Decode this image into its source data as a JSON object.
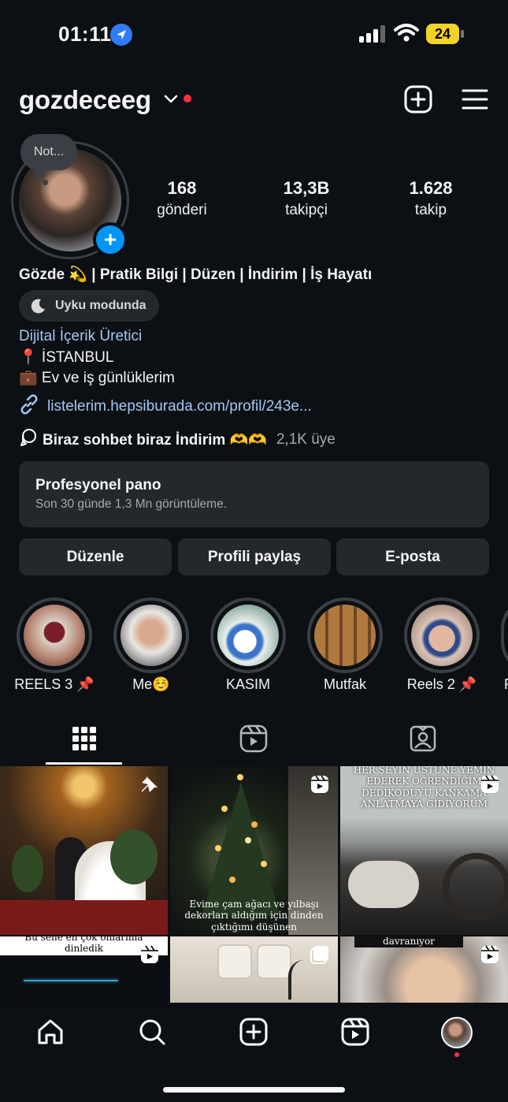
{
  "status_bar": {
    "time": "01:11",
    "battery": "24"
  },
  "header": {
    "username": "gozdeceeg"
  },
  "profile": {
    "note": "Not...",
    "stats": [
      {
        "value": "168",
        "label": "gönderi"
      },
      {
        "value": "13,3B",
        "label": "takipçi"
      },
      {
        "value": "1.628",
        "label": "takip"
      }
    ],
    "bio_name": "Gözde 💫 | Pratik Bilgi | Düzen | İndirim | İş Hayatı",
    "sleep_status": "Uyku modunda",
    "category": "Dijital İçerik Üretici",
    "location": "📍 İSTANBUL",
    "bio_line": "💼 Ev ve iş günlüklerim",
    "link": "listelerim.hepsiburada.com/profil/243e...",
    "channel_name": "Biraz sohbet biraz İndirim 🫶🫶",
    "channel_members": "2,1K üye"
  },
  "pro_panel": {
    "title": "Profesyonel pano",
    "subtitle": "Son 30 günde 1,3 Mn görüntüleme."
  },
  "buttons": {
    "edit": "Düzenle",
    "share": "Profili paylaş",
    "email": "E-posta"
  },
  "highlights": [
    {
      "label": "REELS 3 📌"
    },
    {
      "label": "Me☺️"
    },
    {
      "label": "KASIM"
    },
    {
      "label": "Mutfak"
    },
    {
      "label": "Reels 2 📌"
    },
    {
      "label": "R"
    }
  ],
  "grid": {
    "tile2_caption": "Evime çam ağacı ve yılbaşı dekorları aldığım için dinden çıktığımı düşünen",
    "tile3_caption": "HER ŞEYİN ÜSTÜNE YEMİN EDEREK ÖĞRENDİĞİM DEDİKODUYU KANKAMA ANLATMAYA GİDİYORUM",
    "tile4_caption": "Bu sene en çok onlarınla dinledik",
    "tile6_caption": "davranıyor"
  },
  "colors": {
    "background": "#0c1014",
    "link": "#a4c7f3",
    "accent": "#0095f6",
    "notification": "#ff3040",
    "surface": "#24282d"
  }
}
